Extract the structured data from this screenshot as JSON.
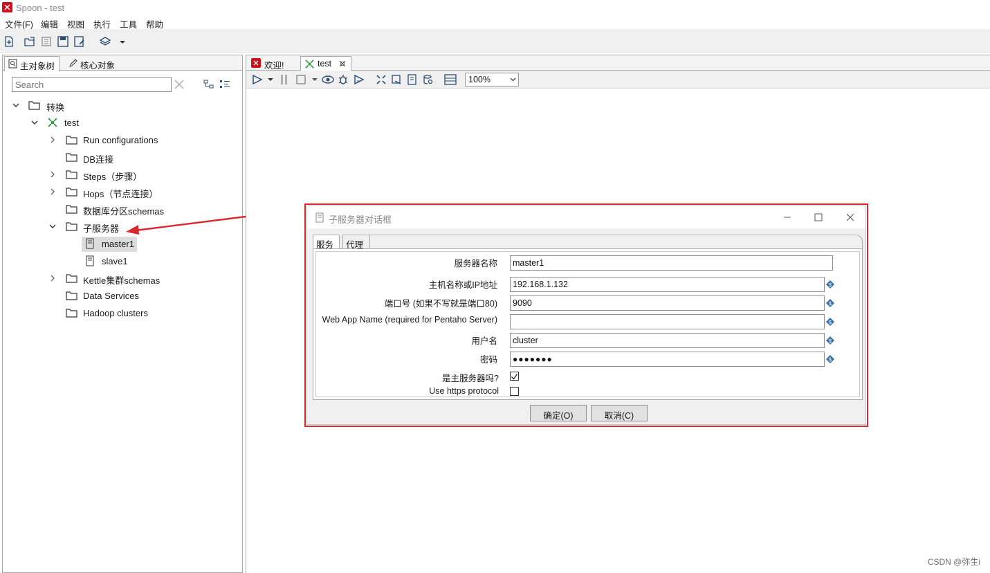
{
  "window": {
    "title": "Spoon - test"
  },
  "menu": [
    "文件(F)",
    "编辑",
    "视图",
    "执行",
    "工具",
    "帮助"
  ],
  "left_panel": {
    "tabs": [
      "主对象树",
      "核心对象"
    ],
    "search_placeholder": "Search",
    "tree": {
      "root": "转换",
      "transform": "test",
      "items": [
        "Run configurations",
        "DB连接",
        "Steps（步骤）",
        "Hops（节点连接）",
        "数据库分区schemas",
        "子服务器",
        "Kettle集群schemas",
        "Data Services",
        "Hadoop clusters"
      ],
      "servers": [
        "master1",
        "slave1"
      ]
    }
  },
  "editor": {
    "tabs": [
      "欢迎!",
      "test"
    ],
    "zoom": "100%"
  },
  "dialog": {
    "title": "子服务器对话框",
    "tabs": [
      "服务",
      "代理"
    ],
    "fields": {
      "server_name_label": "服务器名称",
      "server_name_value": "master1",
      "host_label": "主机名称或IP地址",
      "host_value": "192.168.1.132",
      "port_label": "端口号 (如果不写就是端口80)",
      "port_value": "9090",
      "webapp_label": "Web App Name (required for Pentaho Server)",
      "webapp_value": "",
      "user_label": "用户名",
      "user_value": "cluster",
      "password_label": "密码",
      "password_value": "●●●●●●●",
      "master_label": "是主服务器吗?",
      "master_checked": true,
      "https_label": "Use https protocol",
      "https_checked": false
    },
    "ok_label": "确定(O)",
    "cancel_label": "取消(C)"
  },
  "watermark": "CSDN @弥生i",
  "colors": {
    "annotation_red": "#d9282e",
    "brand_red": "#d0101d",
    "transform_green": "#2e9e3e"
  }
}
